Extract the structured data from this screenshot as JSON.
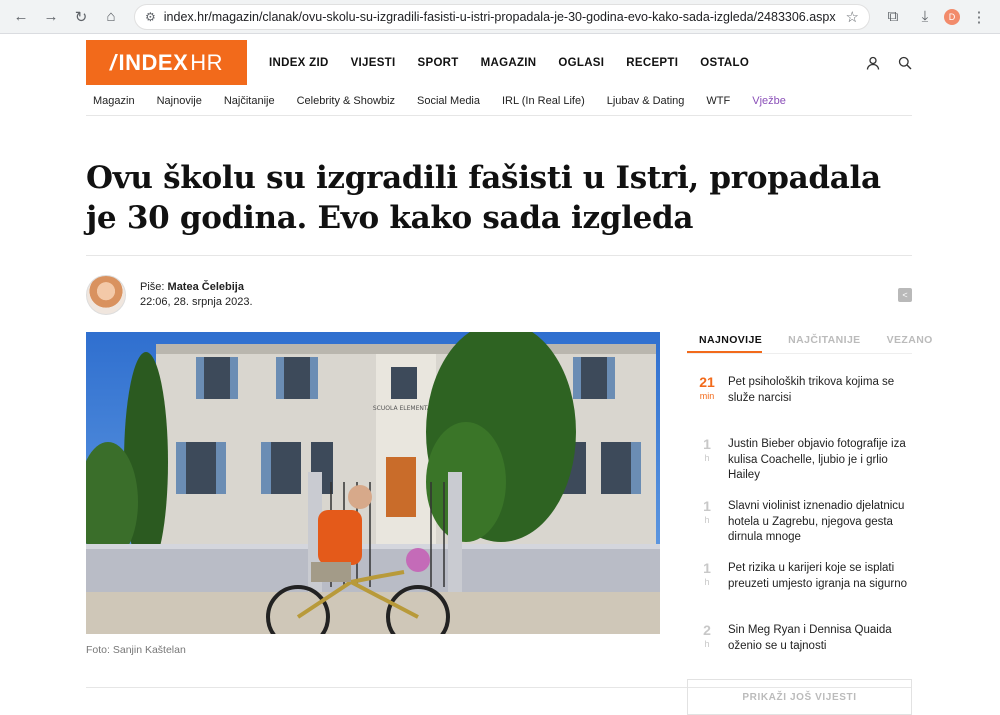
{
  "browser": {
    "url": "index.hr/magazin/clanak/ovu-skolu-su-izgradili-fasisti-u-istri-propadala-je-30-godina-evo-kako-sada-izgleda/2483306.aspx",
    "profile_initial": "D"
  },
  "header": {
    "logo_main": "INDEX",
    "logo_suffix": "HR",
    "nav": [
      "INDEX ZID",
      "VIJESTI",
      "SPORT",
      "MAGAZIN",
      "OGLASI",
      "RECEPTI",
      "OSTALO"
    ]
  },
  "subnav": [
    "Magazin",
    "Najnovije",
    "Najčitanije",
    "Celebrity & Showbiz",
    "Social Media",
    "IRL (In Real Life)",
    "Ljubav & Dating",
    "WTF",
    "Vježbe"
  ],
  "article": {
    "title": "Ovu školu su izgradili fašisti u Istri, propadala je 30 godina. Evo kako sada izgleda",
    "author_label": "Piše:",
    "author_name": "Matea Čelebija",
    "published": "22:06, 28. srpnja 2023.",
    "photo_caption": "Foto: Sanjin Kaštelan",
    "sign_text": "SCUOLA ELEMENTARE"
  },
  "sidebar": {
    "tabs": [
      "NAJNOVIJE",
      "NAJČITANIJE",
      "VEZANO"
    ],
    "items": [
      {
        "num": "21",
        "unit": "min",
        "title": "Pet psiholoških trikova kojima se služe narcisi"
      },
      {
        "num": "1",
        "unit": "h",
        "title": "Justin Bieber objavio fotografije iza kulisa Coachelle, ljubio je i grlio Hailey"
      },
      {
        "num": "1",
        "unit": "h",
        "title": "Slavni violinist iznenadio djelatnicu hotela u Zagrebu, njegova gesta dirnula mnoge"
      },
      {
        "num": "1",
        "unit": "h",
        "title": "Pet rizika u karijeri koje se isplati preuzeti umjesto igranja na sigurno"
      },
      {
        "num": "2",
        "unit": "h",
        "title": "Sin Meg Ryan i Dennisa Quaida oženio se u tajnosti"
      }
    ],
    "more_label": "PRIKAŽI JOŠ VIJESTI"
  },
  "colors": {
    "brand": "#f26a1b",
    "accent_purple": "#8a4fb8"
  }
}
